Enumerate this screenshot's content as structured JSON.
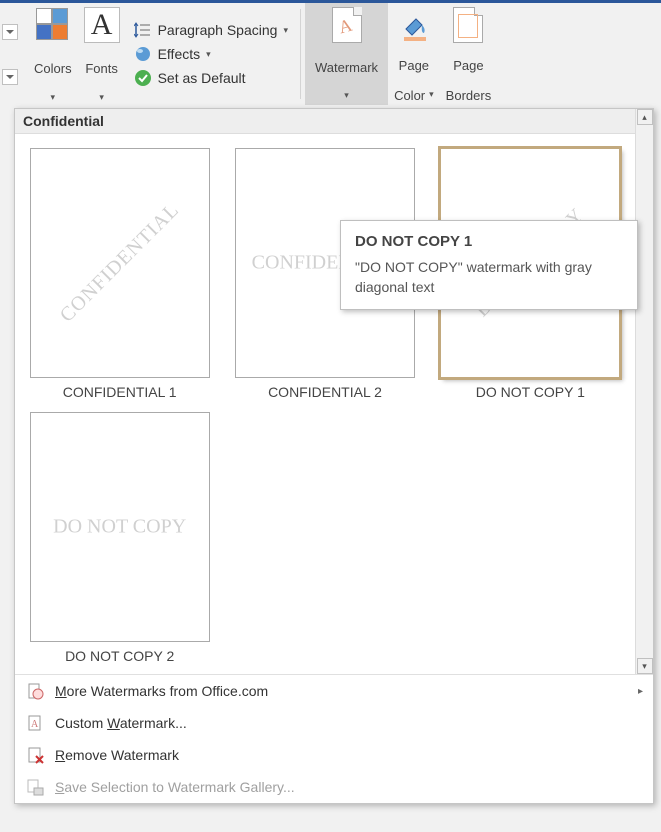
{
  "ribbon": {
    "colors_label": "Colors",
    "fonts_label": "Fonts",
    "fonts_glyph": "A",
    "paragraph_spacing_label": "Paragraph Spacing",
    "effects_label": "Effects",
    "set_default_label": "Set as Default",
    "watermark_label": "Watermark",
    "page_color_label": "Page Color",
    "page_borders_label_line1": "Page",
    "page_borders_label_line2": "Borders",
    "dropdown_glyph": "▾",
    "right_tri": "▸"
  },
  "colors_swatches": [
    "#ffffff",
    "#5b9bd5",
    "#4472c4",
    "#ed7d31"
  ],
  "gallery": {
    "section_title": "Confidential",
    "thumbs": [
      {
        "wm_text": "CONFIDENTIAL",
        "style": "diag",
        "label": "CONFIDENTIAL 1",
        "selected": false
      },
      {
        "wm_text": "CONFIDENTIAL",
        "style": "horz",
        "label": "CONFIDENTIAL 2",
        "selected": false
      },
      {
        "wm_text": "DO NOT COPY",
        "style": "diag",
        "label": "DO NOT COPY 1",
        "selected": true
      },
      {
        "wm_text": "DO NOT COPY",
        "style": "horz",
        "label": "DO NOT COPY 2",
        "selected": false
      }
    ],
    "menu": {
      "more_office": "More Watermarks from Office.com",
      "custom": "Custom Watermark...",
      "remove": "Remove Watermark",
      "save_selection": "Save Selection to Watermark Gallery..."
    }
  },
  "tooltip": {
    "title": "DO NOT COPY 1",
    "body": "\"DO NOT COPY\" watermark with gray diagonal text"
  },
  "scroll": {
    "up": "▴",
    "down": "▾"
  }
}
